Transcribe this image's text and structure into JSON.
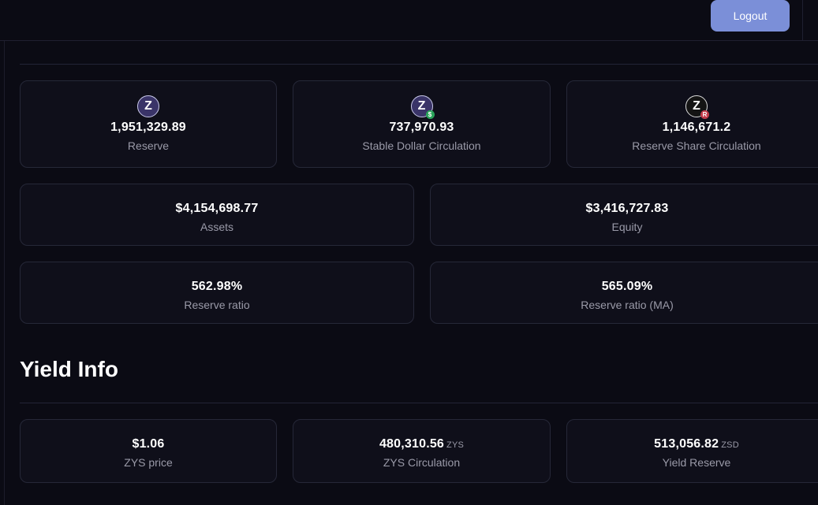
{
  "header": {
    "logout_label": "Logout"
  },
  "stats_top": [
    {
      "value": "1,951,329.89",
      "label": "Reserve",
      "icon": "zephyr-coin-icon",
      "icon_letter": "Z",
      "badge": ""
    },
    {
      "value": "737,970.93",
      "label": "Stable Dollar Circulation",
      "icon": "zephyr-stable-dollar-icon",
      "icon_letter": "Z",
      "badge": "$"
    },
    {
      "value": "1,146,671.2",
      "label": "Reserve Share Circulation",
      "icon": "zephyr-reserve-share-icon",
      "icon_letter": "Z",
      "badge": "R"
    }
  ],
  "stats_mid": [
    {
      "value": "$4,154,698.77",
      "label": "Assets"
    },
    {
      "value": "$3,416,727.83",
      "label": "Equity"
    },
    {
      "value": "562.98%",
      "label": "Reserve ratio"
    },
    {
      "value": "565.09%",
      "label": "Reserve ratio (MA)"
    }
  ],
  "yield": {
    "title": "Yield Info",
    "cards": [
      {
        "value": "$1.06",
        "unit": "",
        "label": "ZYS price"
      },
      {
        "value": "480,310.56",
        "unit": "ZYS",
        "label": "ZYS Circulation"
      },
      {
        "value": "513,056.82",
        "unit": "ZSD",
        "label": "Yield Reserve"
      }
    ]
  },
  "colors": {
    "background": "#0b0b14",
    "card": "#0f0f1a",
    "accent": "#7b8fd8",
    "stable_badge": "#2aa35a",
    "reserve_badge": "#c23a4a"
  }
}
